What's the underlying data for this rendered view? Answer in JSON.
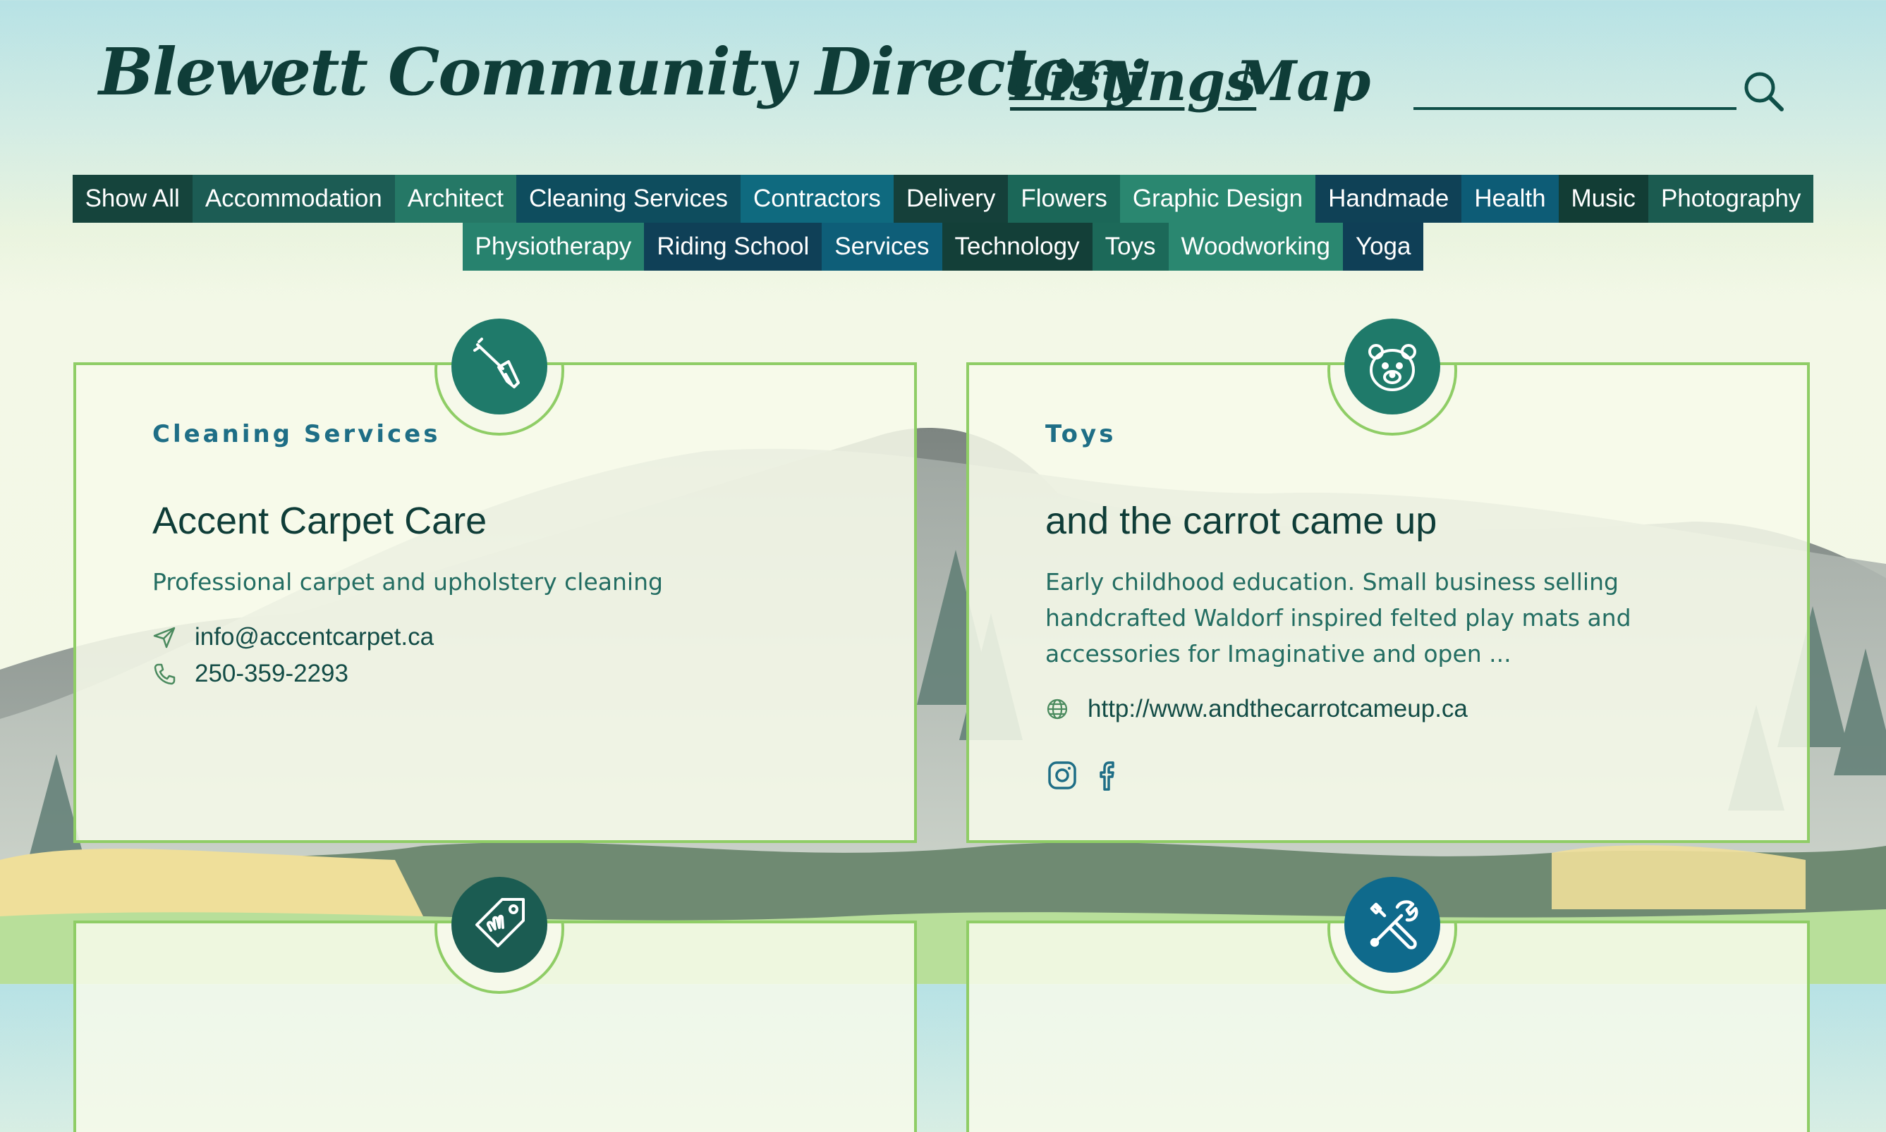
{
  "site": {
    "title": "Blewett Community Directory"
  },
  "nav": {
    "listings": "Listings",
    "map": "Map"
  },
  "search": {
    "value": "",
    "placeholder": ""
  },
  "categories_row1": [
    {
      "label": "Show All",
      "color": "#15443c"
    },
    {
      "label": "Accommodation",
      "color": "#1c5c54"
    },
    {
      "label": "Architect",
      "color": "#257866"
    },
    {
      "label": "Cleaning Services",
      "color": "#0e4d5e"
    },
    {
      "label": "Contractors",
      "color": "#0f6a7f"
    },
    {
      "label": "Delivery",
      "color": "#15403a"
    },
    {
      "label": "Flowers",
      "color": "#1b6758"
    },
    {
      "label": "Graphic Design",
      "color": "#2a8770"
    },
    {
      "label": "Handmade",
      "color": "#0f4156"
    },
    {
      "label": "Health",
      "color": "#0d5c76"
    },
    {
      "label": "Music",
      "color": "#123d35"
    },
    {
      "label": "Photography",
      "color": "#1b5b50"
    }
  ],
  "categories_row2": [
    {
      "label": "Physiotherapy",
      "color": "#27826e"
    },
    {
      "label": "Riding School",
      "color": "#0f4057"
    },
    {
      "label": "Services",
      "color": "#0e5e78"
    },
    {
      "label": "Technology",
      "color": "#133f38"
    },
    {
      "label": "Toys",
      "color": "#1c6959"
    },
    {
      "label": "Woodworking",
      "color": "#2a8770"
    },
    {
      "label": "Yoga",
      "color": "#0f3f56"
    }
  ],
  "listings": [
    {
      "category": "Cleaning Services",
      "title": "Accent Carpet Care",
      "description": "Professional carpet and upholstery cleaning",
      "email": "info@accentcarpet.ca",
      "phone": "250-359-2293",
      "icon": "broom-icon",
      "badge_color": "#1f7a6a"
    },
    {
      "category": "Toys",
      "title": "and the carrot came up",
      "description": "Early childhood education. Small business selling handcrafted Waldorf inspired felted play mats and accessories for Imaginative and open ...",
      "website": "http://www.andthecarrotcameup.ca",
      "social": [
        "instagram-icon",
        "facebook-icon"
      ],
      "icon": "bear-face-icon",
      "badge_color": "#1f7a6a"
    },
    {
      "icon": "price-tag-hand-icon",
      "badge_color": "#1b5c52"
    },
    {
      "icon": "tools-icon",
      "badge_color": "#0f6a8c"
    }
  ],
  "colors": {
    "title": "#0f3d38",
    "card_border": "#8fcd66",
    "card_category": "#1e6e86",
    "body_text": "#236d62"
  }
}
